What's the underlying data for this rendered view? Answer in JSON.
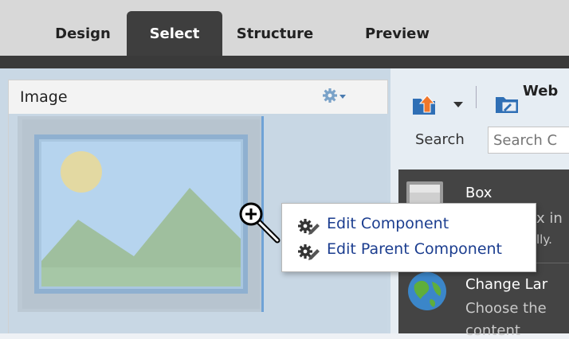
{
  "tabs": [
    {
      "label": "Design",
      "active": false
    },
    {
      "label": "Select",
      "active": true
    },
    {
      "label": "Structure",
      "active": false
    },
    {
      "label": "Preview",
      "active": false
    }
  ],
  "component": {
    "title": "Image",
    "menu_icon": "gear-dropdown-icon"
  },
  "toolbar": {
    "web_label": "Web",
    "icons": [
      "upload-folder-icon",
      "chevron-down-icon",
      "web-folder-icon"
    ]
  },
  "search": {
    "label": "Search",
    "placeholder": "Search C"
  },
  "list": [
    {
      "title": "Box",
      "desc_lines": [
        "x in",
        "lly."
      ],
      "icon": "box-icon"
    },
    {
      "title": "Change Lar",
      "desc_lines": [
        "Choose the",
        "content"
      ],
      "icon": "globe-icon"
    }
  ],
  "context_menu": {
    "items": [
      {
        "label": "Edit Component",
        "icon": "gear-edit-icon"
      },
      {
        "label": "Edit Parent Component",
        "icon": "gear-edit-icon"
      }
    ]
  },
  "colors": {
    "active_tab": "#3e3e3e",
    "panel_bg": "#c9d8e5",
    "menu_link": "#1b3d8f"
  }
}
